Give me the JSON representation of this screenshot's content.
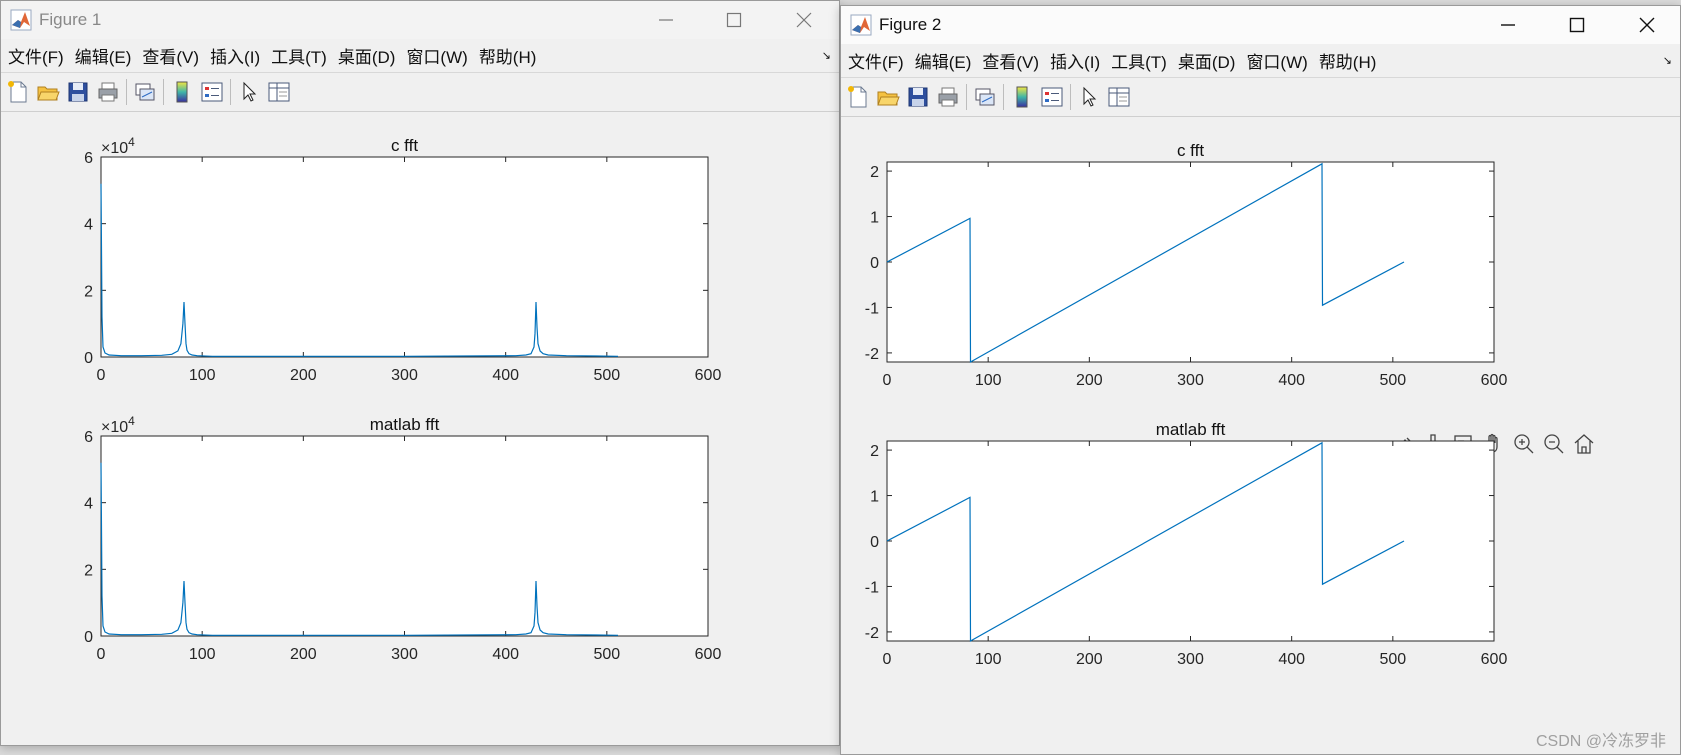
{
  "figure1": {
    "window_title": "Figure 1",
    "menu": [
      "文件(F)",
      "编辑(E)",
      "查看(V)",
      "插入(I)",
      "工具(T)",
      "桌面(D)",
      "窗口(W)",
      "帮助(H)"
    ],
    "menu_overflow_glyph": "↘"
  },
  "figure2": {
    "window_title": "Figure 2",
    "menu": [
      "文件(F)",
      "编辑(E)",
      "查看(V)",
      "插入(I)",
      "工具(T)",
      "桌面(D)",
      "窗口(W)",
      "帮助(H)"
    ],
    "menu_overflow_glyph": "↘"
  },
  "toolbar_icons": [
    "new-figure-icon",
    "open-file-icon",
    "save-icon",
    "print-icon",
    "link-plot-icon",
    "colorbar-icon",
    "legend-icon",
    "pointer-icon",
    "property-inspector-icon"
  ],
  "axes_toolbar_icons": [
    "data-tips-icon",
    "brush-icon",
    "data-cursor-icon",
    "pan-hand-icon",
    "zoom-in-icon",
    "zoom-out-icon",
    "home-icon"
  ],
  "watermark": "CSDN @冷冻罗非",
  "colors": {
    "line": "#0072bd",
    "axes_bg": "#ffffff",
    "figure_bg": "#f0f0f0"
  },
  "chart_data": [
    {
      "figure": "Figure 1",
      "position": "top",
      "type": "line",
      "title": "c fft",
      "xlabel": "",
      "ylabel": "",
      "exponent_label": {
        "base": "×10",
        "power": "4"
      },
      "xlim": [
        0,
        600
      ],
      "ylim": [
        0,
        6
      ],
      "xticks": [
        0,
        100,
        200,
        300,
        400,
        500,
        600
      ],
      "yticks": [
        0,
        2,
        4,
        6
      ],
      "series": [
        {
          "x": [
            0,
            1,
            2,
            4,
            8,
            20,
            40,
            60,
            70,
            76,
            79,
            81,
            82,
            83,
            84,
            85,
            87,
            90,
            95,
            110,
            200,
            300,
            410,
            420,
            425,
            428,
            429,
            430,
            431,
            432,
            434,
            437,
            442,
            460,
            490,
            511
          ],
          "y": [
            5.2,
            1.2,
            0.3,
            0.12,
            0.06,
            0.04,
            0.04,
            0.05,
            0.08,
            0.18,
            0.4,
            1.0,
            1.65,
            1.0,
            0.4,
            0.2,
            0.1,
            0.06,
            0.04,
            0.02,
            0.02,
            0.02,
            0.04,
            0.06,
            0.1,
            0.3,
            0.7,
            1.65,
            0.9,
            0.4,
            0.18,
            0.1,
            0.06,
            0.04,
            0.03,
            0.02
          ]
        }
      ]
    },
    {
      "figure": "Figure 1",
      "position": "bottom",
      "type": "line",
      "title": "matlab fft",
      "xlabel": "",
      "ylabel": "",
      "exponent_label": {
        "base": "×10",
        "power": "4"
      },
      "xlim": [
        0,
        600
      ],
      "ylim": [
        0,
        6
      ],
      "xticks": [
        0,
        100,
        200,
        300,
        400,
        500,
        600
      ],
      "yticks": [
        0,
        2,
        4,
        6
      ],
      "series": [
        {
          "x": [
            0,
            1,
            2,
            4,
            8,
            20,
            40,
            60,
            70,
            76,
            79,
            81,
            82,
            83,
            84,
            85,
            87,
            90,
            95,
            110,
            200,
            300,
            410,
            420,
            425,
            428,
            429,
            430,
            431,
            432,
            434,
            437,
            442,
            460,
            490,
            511
          ],
          "y": [
            5.2,
            1.2,
            0.3,
            0.12,
            0.06,
            0.04,
            0.04,
            0.05,
            0.08,
            0.18,
            0.4,
            1.0,
            1.65,
            1.0,
            0.4,
            0.2,
            0.1,
            0.06,
            0.04,
            0.02,
            0.02,
            0.02,
            0.04,
            0.06,
            0.1,
            0.3,
            0.7,
            1.65,
            0.9,
            0.4,
            0.18,
            0.1,
            0.06,
            0.04,
            0.03,
            0.02
          ]
        }
      ]
    },
    {
      "figure": "Figure 2",
      "position": "top",
      "type": "line",
      "title": "c fft",
      "xlabel": "",
      "ylabel": "",
      "xlim": [
        0,
        600
      ],
      "ylim": [
        -2.2,
        2.2
      ],
      "xticks": [
        0,
        100,
        200,
        300,
        400,
        500,
        600
      ],
      "yticks": [
        -2,
        -1,
        0,
        1,
        2
      ],
      "series": [
        {
          "x": [
            0,
            82,
            82.5,
            430,
            430.5,
            511
          ],
          "y": [
            0,
            0.96,
            -2.2,
            2.16,
            -0.95,
            0
          ]
        }
      ]
    },
    {
      "figure": "Figure 2",
      "position": "bottom",
      "type": "line",
      "title": "matlab fft",
      "xlabel": "",
      "ylabel": "",
      "xlim": [
        0,
        600
      ],
      "ylim": [
        -2.2,
        2.2
      ],
      "xticks": [
        0,
        100,
        200,
        300,
        400,
        500,
        600
      ],
      "yticks": [
        -2,
        -1,
        0,
        1,
        2
      ],
      "series": [
        {
          "x": [
            0,
            82,
            82.5,
            430,
            430.5,
            511
          ],
          "y": [
            0,
            0.96,
            -2.2,
            2.16,
            -0.95,
            0
          ]
        }
      ]
    }
  ]
}
